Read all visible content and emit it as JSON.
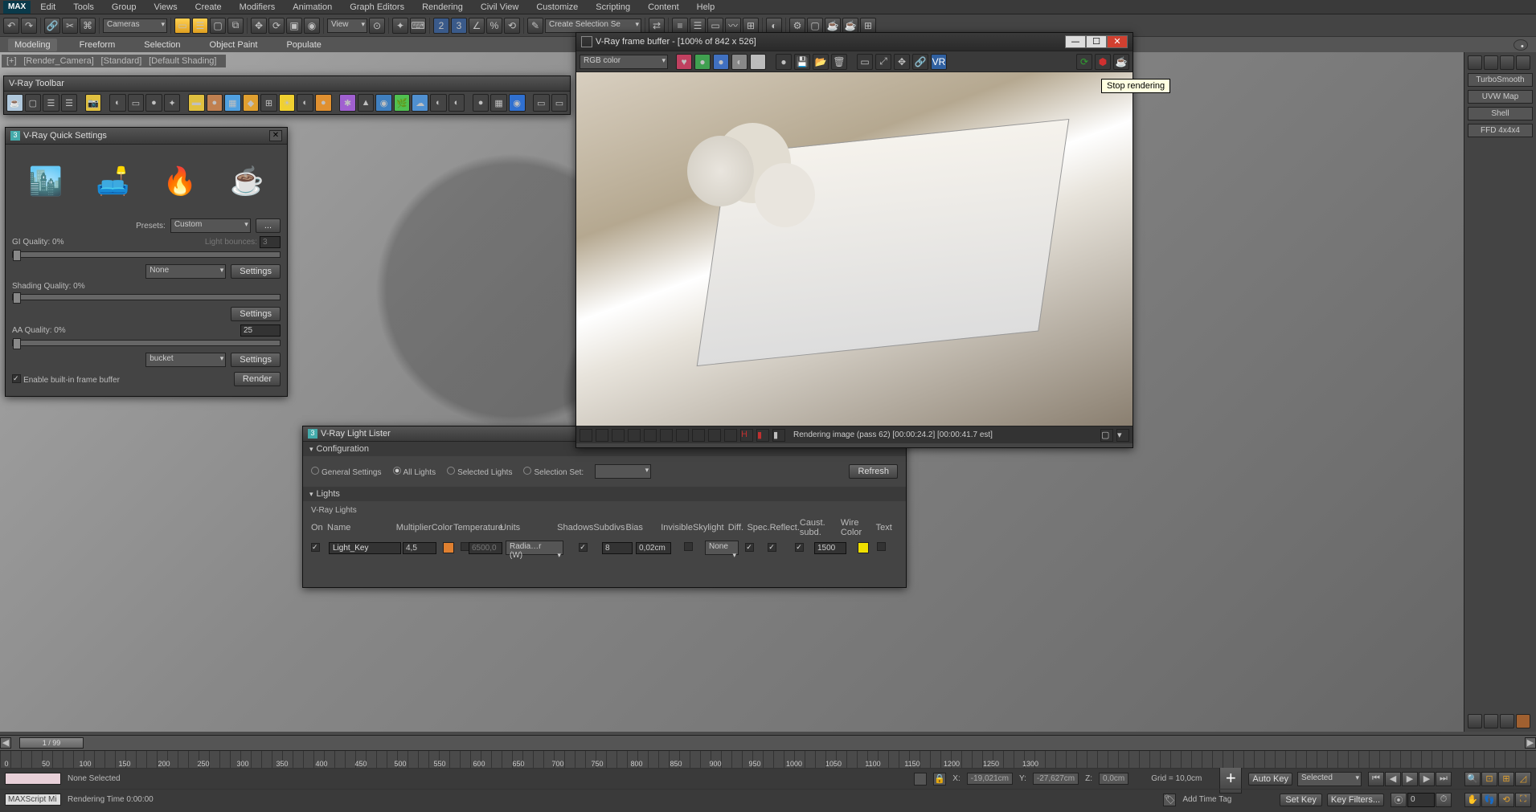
{
  "menubar": [
    "Edit",
    "Tools",
    "Group",
    "Views",
    "Create",
    "Modifiers",
    "Animation",
    "Graph Editors",
    "Rendering",
    "Civil View",
    "Customize",
    "Scripting",
    "Content",
    "Help"
  ],
  "max_label": "MAX",
  "main_tb": {
    "cameras": "Cameras",
    "view": "View",
    "sel_set": "Create Selection Se"
  },
  "ribbon": [
    "Modeling",
    "Freeform",
    "Selection",
    "Object Paint",
    "Populate"
  ],
  "vp_label": {
    "p1": "[+]",
    "p2": "[Render_Camera]",
    "p3": "[Standard]",
    "p4": "[Default Shading]"
  },
  "vray_toolbar_title": "V-Ray Toolbar",
  "quick": {
    "title": "V-Ray Quick Settings",
    "presets_lbl": "Presets:",
    "preset_val": "Custom",
    "dots": "...",
    "gi": "GI Quality: 0%",
    "lb_lbl": "Light bounces:",
    "lb_val": "3",
    "settings": "Settings",
    "none": "None",
    "shading": "Shading Quality: 0%",
    "aa": "AA Quality: 0%",
    "aa_val": "25",
    "bucket": "bucket",
    "enable": "Enable built-in frame buffer",
    "render": "Render"
  },
  "lister": {
    "title": "V-Ray Light Lister",
    "config": "Configuration",
    "gen": "General Settings",
    "all": "All Lights",
    "sel": "Selected Lights",
    "set": "Selection Set:",
    "refresh": "Refresh",
    "lights_hdr": "Lights",
    "vray_lights": "V-Ray Lights",
    "cols": {
      "on": "On",
      "name": "Name",
      "mult": "Multiplier",
      "color": "Color",
      "temp": "Temperature",
      "units": "Units",
      "shadows": "Shadows",
      "subdivs": "Subdivs",
      "bias": "Bias",
      "invisible": "Invisible",
      "skylight": "Skylight",
      "diff": "Diff.",
      "spec": "Spec.",
      "reflect": "Reflect.",
      "caust": "Caust. subd.",
      "wirec": "Wire Color",
      "text": "Text"
    },
    "row": {
      "name": "Light_Key",
      "mult": "4,5",
      "temp": "6500,0",
      "units": "Radia…r (W)",
      "subdivs": "8",
      "bias": "0,02cm",
      "skylight": "None",
      "caust": "1500",
      "color": "#e08030",
      "wire": "#f0e000"
    }
  },
  "vfb": {
    "title": "V-Ray frame buffer - [100% of 842 x 526]",
    "rgb": "RGB color",
    "status": "Rendering image (pass 62) [00:00:24.2] [00:00:41.7 est]",
    "tooltip": "Stop rendering"
  },
  "cmd": {
    "mods": [
      "TurboSmooth",
      "UVW Map",
      "Shell",
      "FFD 4x4x4"
    ]
  },
  "timeline": {
    "pos": "1 / 99",
    "ticks": [
      0,
      50,
      100,
      150,
      200,
      250,
      300,
      350,
      400,
      450,
      500,
      550,
      600,
      650,
      700,
      750,
      800,
      850,
      900,
      950,
      1000,
      1050,
      1100,
      1150,
      1200,
      1250,
      1300
    ],
    "none_sel": "None Selected",
    "x": "X:",
    "xv": "-19,021cm",
    "y": "Y:",
    "yv": "-27,627cm",
    "z": "Z:",
    "zv": "0,0cm",
    "grid": "Grid = 10,0cm",
    "autokey": "Auto Key",
    "selected": "Selected",
    "setkey": "Set Key",
    "keyfilters": "Key Filters...",
    "rendertime": "Rendering Time  0:00:00",
    "maxscript": "MAXScript Mi",
    "addtag": "Add Time Tag"
  }
}
